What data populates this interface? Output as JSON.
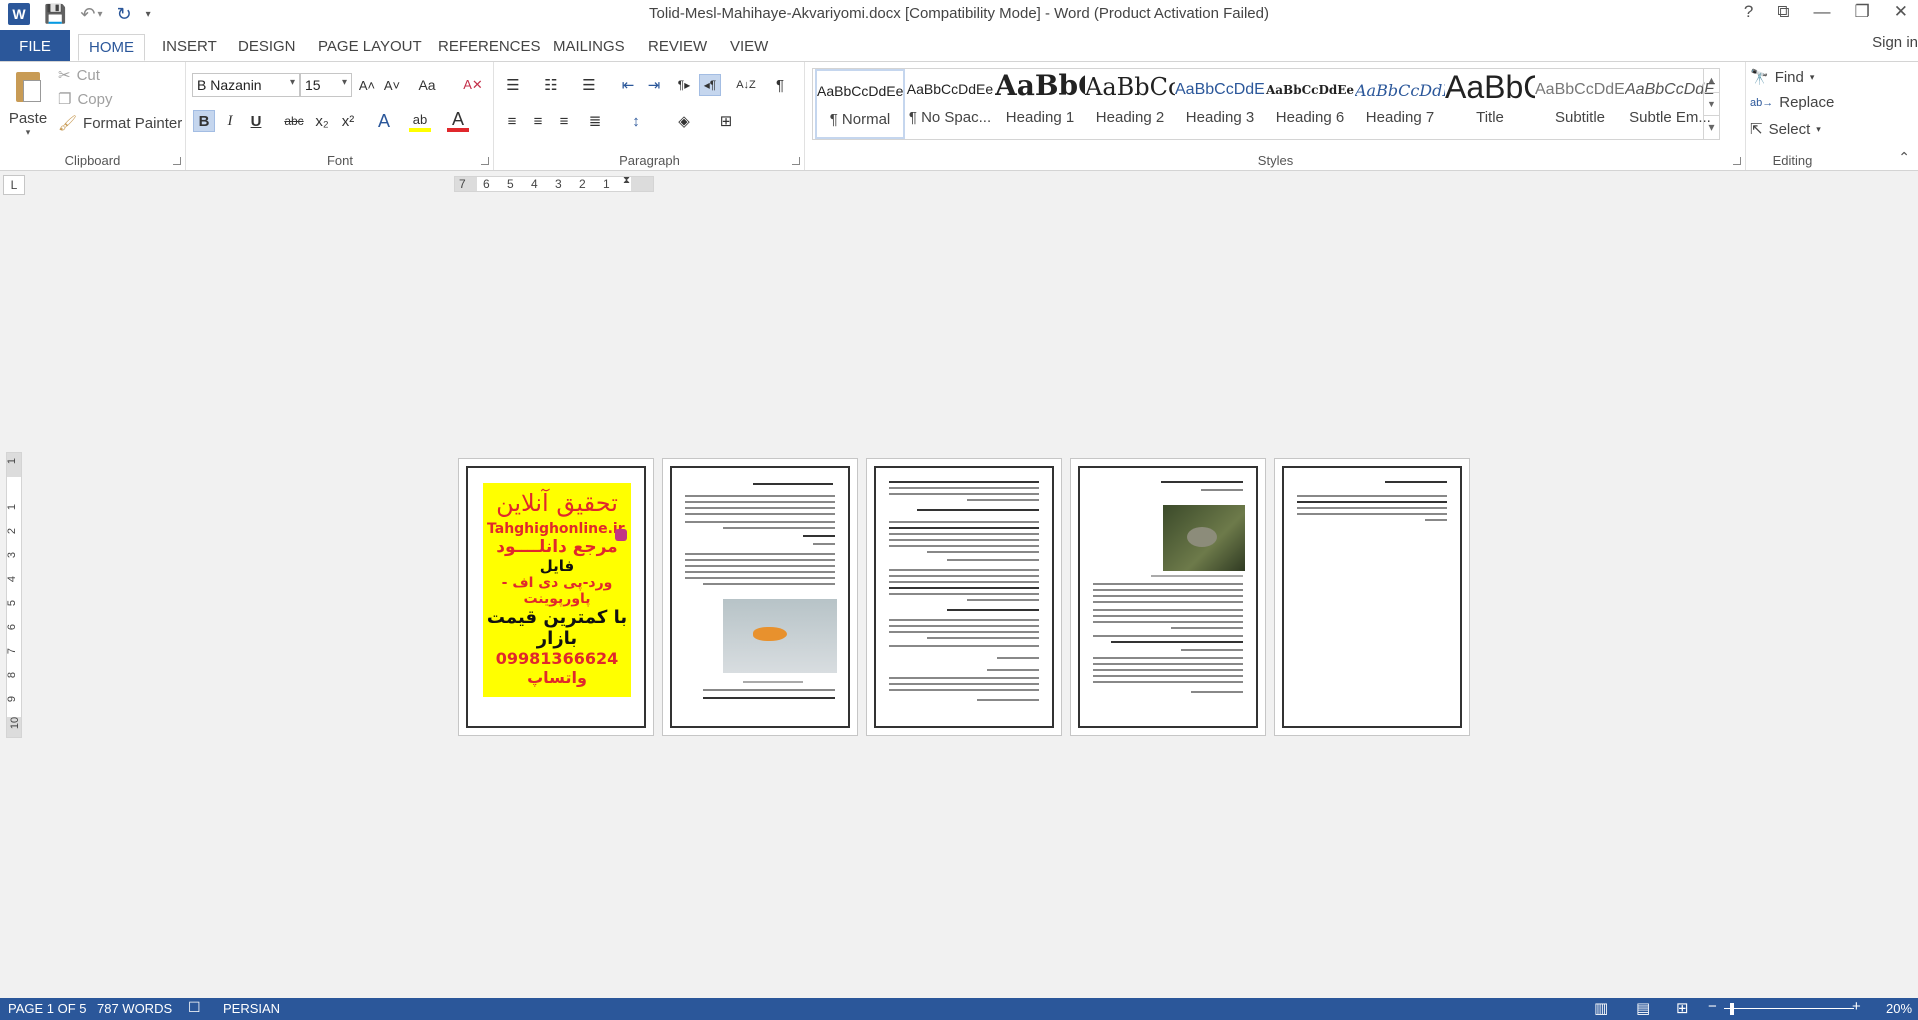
{
  "window": {
    "title": "Tolid-Mesl-Mahihaye-Akvariyomi.docx [Compatibility Mode] - Word (Product Activation Failed)",
    "controls": [
      "?",
      "⧉",
      "—",
      "❐",
      "✕"
    ]
  },
  "quick_access": {
    "app_logo": "W",
    "save": "💾",
    "undo": "↶",
    "undo_dd": "▾",
    "redo": "↻",
    "customize": "▾"
  },
  "tabs": [
    "FILE",
    "HOME",
    "INSERT",
    "DESIGN",
    "PAGE LAYOUT",
    "REFERENCES",
    "MAILINGS",
    "REVIEW",
    "VIEW"
  ],
  "sign_in": "Sign in",
  "clipboard": {
    "paste": "Paste",
    "cut": "Cut",
    "copy": "Copy",
    "format_painter": "Format Painter",
    "label": "Clipboard"
  },
  "font": {
    "name": "B Nazanin",
    "size": "15",
    "label": "Font",
    "grow": "A˄",
    "shrink": "A˅",
    "case": "Aa",
    "clear": "A✕",
    "bold": "B",
    "italic": "I",
    "underline": "U",
    "strike": "abc",
    "subscript": "x₂",
    "superscript": "x²",
    "effects": "A",
    "highlight": "ab",
    "color": "A"
  },
  "paragraph": {
    "label": "Paragraph",
    "bullets": "☰",
    "numbering": "☷",
    "multilevel": "☰",
    "decrease_indent": "⇤",
    "increase_indent": "⇥",
    "ltr": "¶▸",
    "rtl": "◂¶",
    "sort": "A↓Z",
    "show_marks": "¶",
    "align_left": "≡",
    "align_center": "≡",
    "align_right": "≡",
    "justify": "≣",
    "line_spacing": "↕",
    "shading": "◈",
    "borders": "⊞"
  },
  "styles": {
    "label": "Styles",
    "items": [
      {
        "preview": "AaBbCcDdEe",
        "name": "¶ Normal"
      },
      {
        "preview": "AaBbCcDdEe",
        "name": "¶ No Spac..."
      },
      {
        "preview": "AaBbCcDdEe",
        "name": "Heading 1"
      },
      {
        "preview": "AaBbCcDdEe",
        "name": "Heading 2"
      },
      {
        "preview": "AaBbCcDdEe",
        "name": "Heading 3"
      },
      {
        "preview": "AaBbCcDdEe",
        "name": "Heading 6"
      },
      {
        "preview": "AaBbCcDdEe",
        "name": "Heading 7"
      },
      {
        "preview": "AaBbCcDdEe",
        "name": "Title"
      },
      {
        "preview": "AaBbCcDdEe",
        "name": "Subtitle"
      },
      {
        "preview": "AaBbCcDdEe",
        "name": "Subtle Em..."
      }
    ],
    "scroll_up": "▲",
    "scroll_down": "▼",
    "more": "▾"
  },
  "editing": {
    "label": "Editing",
    "find": "Find",
    "replace": "Replace",
    "select": "Select",
    "collapse": "⌃"
  },
  "ruler": {
    "tab_selector": "L",
    "h_numbers": [
      "7",
      "6",
      "5",
      "4",
      "3",
      "2",
      "1"
    ],
    "v_numbers": [
      "1",
      "1",
      "2",
      "3",
      "4",
      "5",
      "6",
      "7",
      "8",
      "9",
      "10"
    ]
  },
  "ad_page": {
    "heading": "تحقیق آنلاین",
    "site": "Tahghighonline.ir",
    "line1": "مرجع دانلــــود",
    "line2": "فایل",
    "line3": "ورد-پی دی اف - پاورپوینت",
    "line4": "با کمترین قیمت بازار",
    "line5": "09981366624 واتساپ"
  },
  "status": {
    "page": "PAGE 1 OF 5",
    "words": "787 WORDS",
    "proofing": "☐",
    "language": "PERSIAN",
    "read_mode": "▥",
    "print_layout": "▤",
    "web_layout": "⊞",
    "zoom_out": "−",
    "zoom_in": "+",
    "zoom": "20%"
  },
  "colors": {
    "accent": "#2b579a",
    "ad_yellow": "#ffff00",
    "ad_red": "#e0282c"
  }
}
